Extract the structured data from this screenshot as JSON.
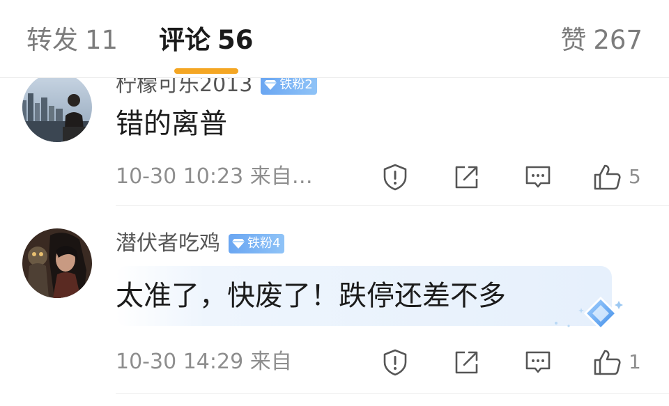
{
  "tabs": {
    "reposts": {
      "label": "转发",
      "count": "11"
    },
    "comments": {
      "label": "评论",
      "count": "56"
    },
    "likes": {
      "label": "赞",
      "count": "267"
    }
  },
  "colors": {
    "accent": "#f4a623",
    "badge": "#6aa6f2"
  },
  "comments": [
    {
      "username": "柠檬可乐2013",
      "badge": "铁粉2",
      "text": "错的离普",
      "meta": "10-30 10:23 来自…",
      "likes": "5"
    },
    {
      "username": "潜伏者吃鸡",
      "badge": "铁粉4",
      "text": "太准了，快废了！跌停还差不多",
      "meta": "10-30 14:29 来自",
      "likes": "1"
    }
  ],
  "icons": [
    "report-icon",
    "share-icon",
    "reply-icon",
    "like-icon",
    "diamond-icon"
  ]
}
